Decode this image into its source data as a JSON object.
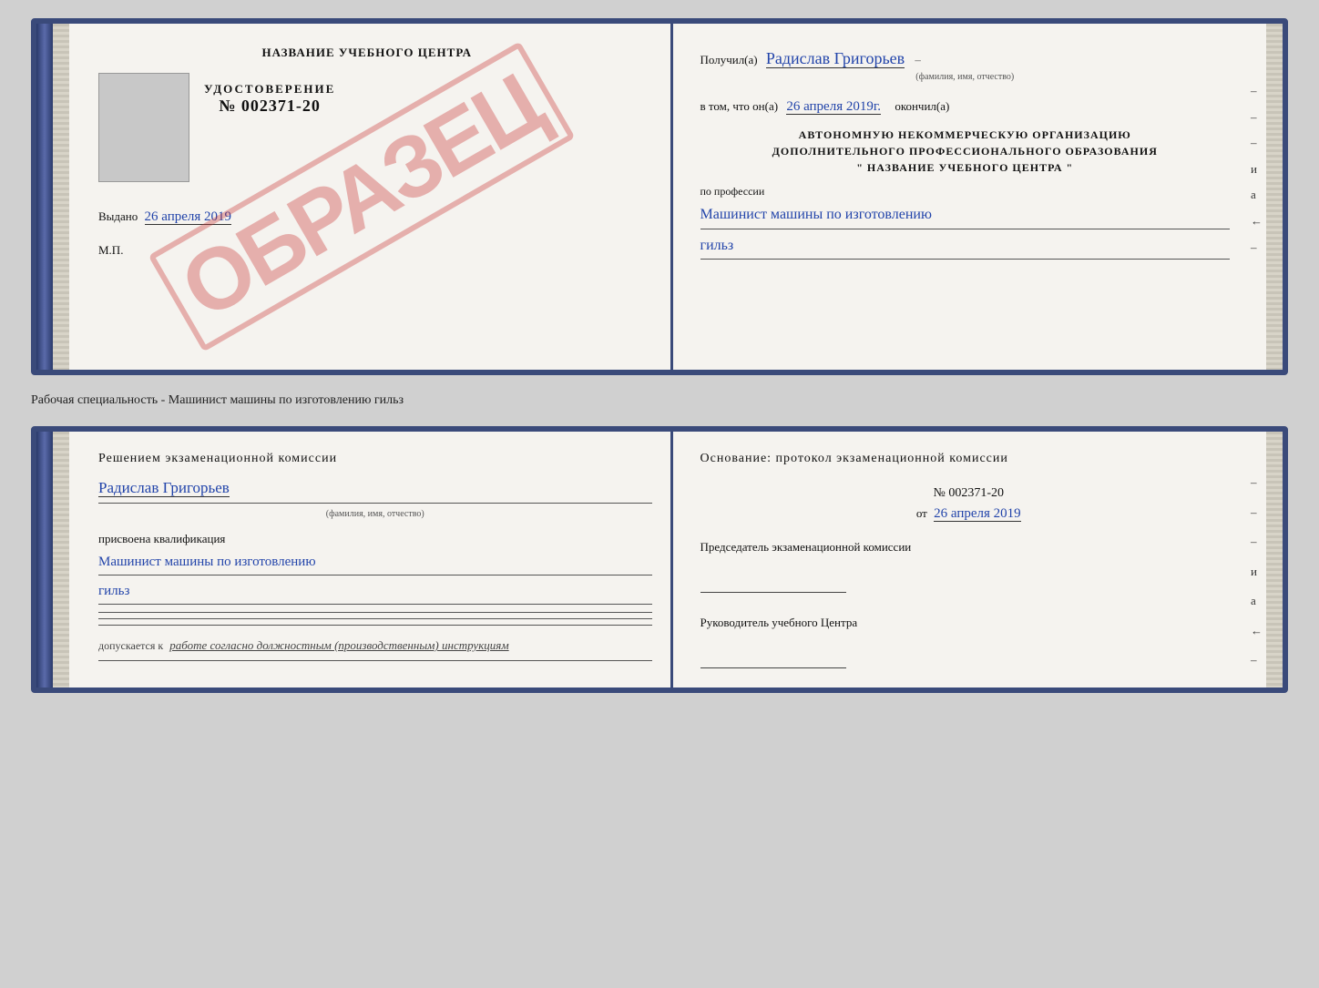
{
  "top_doc": {
    "left": {
      "title": "НАЗВАНИЕ УЧЕБНОГО ЦЕНТРА",
      "watermark": "ОБРАЗЕЦ",
      "udostoverenie_label": "УДОСТОВЕРЕНИЕ",
      "udostoverenie_num": "№ 002371-20",
      "vidan_label": "Выдано",
      "vidan_date": "26 апреля 2019",
      "mp_label": "М.П."
    },
    "right": {
      "poluchil_label": "Получил(а)",
      "poluchil_name": "Радислав Григорьев",
      "poluchil_sub": "(фамилия, имя, отчество)",
      "v_tom_label": "в том, что он(а)",
      "v_tom_date": "26 апреля 2019г.",
      "okonchil_label": "окончил(а)",
      "org_line1": "АВТОНОМНУЮ НЕКОММЕРЧЕСКУЮ ОРГАНИЗАЦИЮ",
      "org_line2": "ДОПОЛНИТЕЛЬНОГО ПРОФЕССИОНАЛЬНОГО ОБРАЗОВАНИЯ",
      "org_name": "\"  НАЗВАНИЕ УЧЕБНОГО ЦЕНТРА  \"",
      "po_professii_label": "по профессии",
      "profession1": "Машинист машины по изготовлению",
      "profession2": "гильз",
      "dash1": "–",
      "dash2": "–",
      "dash3": "–",
      "dash4": "и",
      "dash5": "а",
      "dash6": "←",
      "dash7": "–"
    }
  },
  "label": "Рабочая специальность - Машинист машины по изготовлению гильз",
  "bottom_doc": {
    "left": {
      "resheniem_label": "Решением  экзаменационной  комиссии",
      "name_handwritten": "Радислав Григорьев",
      "name_sub": "(фамилия, имя, отчество)",
      "prisvoena_label": "присвоена квалификация",
      "qualification1": "Машинист машины по изготовлению",
      "qualification2": "гильз",
      "dopusk_label": "допускается к",
      "dopusk_text": "работе согласно должностным (производственным) инструкциям"
    },
    "right": {
      "osnovanie_label": "Основание: протокол экзаменационной  комиссии",
      "num_label": "№  002371-20",
      "ot_label": "от",
      "ot_date": "26 апреля 2019",
      "predsedatel_label": "Председатель экзаменационной комиссии",
      "rukovoditel_label": "Руководитель учебного Центра",
      "dash1": "–",
      "dash2": "–",
      "dash3": "–",
      "dash4": "и",
      "dash5": "а",
      "dash6": "←",
      "dash7": "–",
      "dash8": "–",
      "dash9": "–",
      "dash10": "–"
    }
  }
}
